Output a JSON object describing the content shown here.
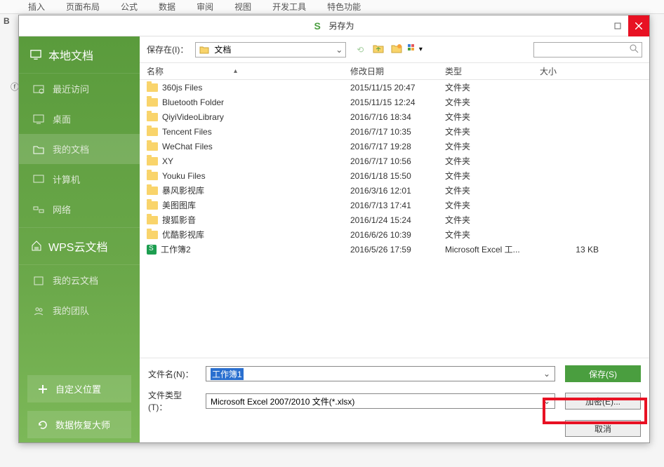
{
  "ribbon": {
    "tabs": [
      "插入",
      "页面布局",
      "公式",
      "数据",
      "审阅",
      "视图",
      "开发工具",
      "特色功能"
    ]
  },
  "dialog": {
    "title": "另存为",
    "save_in_label": "保存在(I)：",
    "save_in_value": "文档",
    "sidebar": {
      "local_header": "本地文档",
      "recent": "最近访问",
      "desktop": "桌面",
      "mydocs": "我的文档",
      "computer": "计算机",
      "network": "网络",
      "cloud_header": "WPS云文档",
      "mycloud": "我的云文档",
      "myteam": "我的团队",
      "custom_location": "自定义位置",
      "data_recovery": "数据恢复大师"
    },
    "columns": {
      "name": "名称",
      "modified": "修改日期",
      "type": "类型",
      "size": "大小"
    },
    "files": [
      {
        "name": "360js Files",
        "date": "2015/11/15 20:47",
        "type": "文件夹",
        "size": "",
        "kind": "folder"
      },
      {
        "name": "Bluetooth Folder",
        "date": "2015/11/15 12:24",
        "type": "文件夹",
        "size": "",
        "kind": "folder"
      },
      {
        "name": "QiyiVideoLibrary",
        "date": "2016/7/16 18:34",
        "type": "文件夹",
        "size": "",
        "kind": "folder"
      },
      {
        "name": "Tencent Files",
        "date": "2016/7/17 10:35",
        "type": "文件夹",
        "size": "",
        "kind": "folder"
      },
      {
        "name": "WeChat Files",
        "date": "2016/7/17 19:28",
        "type": "文件夹",
        "size": "",
        "kind": "folder"
      },
      {
        "name": "XY",
        "date": "2016/7/17 10:56",
        "type": "文件夹",
        "size": "",
        "kind": "folder"
      },
      {
        "name": "Youku Files",
        "date": "2016/1/18 15:50",
        "type": "文件夹",
        "size": "",
        "kind": "folder"
      },
      {
        "name": "暴风影视库",
        "date": "2016/3/16 12:01",
        "type": "文件夹",
        "size": "",
        "kind": "folder"
      },
      {
        "name": "美图图库",
        "date": "2016/7/13 17:41",
        "type": "文件夹",
        "size": "",
        "kind": "folder"
      },
      {
        "name": "搜狐影音",
        "date": "2016/1/24 15:24",
        "type": "文件夹",
        "size": "",
        "kind": "folder"
      },
      {
        "name": "优酷影视库",
        "date": "2016/6/26 10:39",
        "type": "文件夹",
        "size": "",
        "kind": "folder"
      },
      {
        "name": "工作簿2",
        "date": "2016/5/26 17:59",
        "type": "Microsoft Excel 工...",
        "size": "13 KB",
        "kind": "xls"
      }
    ],
    "filename_label": "文件名(N)：",
    "filename_value": "工作簿1",
    "filetype_label": "文件类型(T)：",
    "filetype_value": "Microsoft Excel 2007/2010 文件(*.xlsx)",
    "save_btn": "保存(S)",
    "encrypt_btn": "加密(E)...",
    "cancel_btn": "取消"
  }
}
